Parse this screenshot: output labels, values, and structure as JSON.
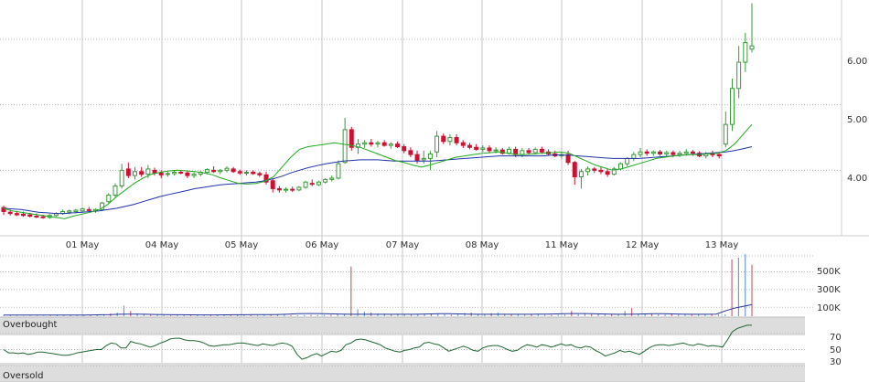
{
  "chart_data": [
    {
      "panel": "price",
      "type": "candlestick",
      "x_labels": [
        "01 May",
        "04 May",
        "05 May",
        "06 May",
        "07 May",
        "08 May",
        "11 May",
        "12 May",
        "13 May"
      ],
      "y_ticks": [
        "4.00",
        "5.00",
        "6.00"
      ],
      "ylim": [
        3.0,
        6.6
      ],
      "grid": true,
      "colors": {
        "up": "#3a9a3a",
        "down": "#cc1133",
        "ma_short": "#22aa22",
        "ma_long": "#2233aa",
        "grid": "#bbbbbb"
      },
      "candles": [
        {
          "o": 3.43,
          "h": 3.46,
          "l": 3.32,
          "c": 3.37
        },
        {
          "o": 3.36,
          "h": 3.4,
          "l": 3.31,
          "c": 3.34
        },
        {
          "o": 3.34,
          "h": 3.38,
          "l": 3.3,
          "c": 3.32
        },
        {
          "o": 3.33,
          "h": 3.37,
          "l": 3.29,
          "c": 3.31
        },
        {
          "o": 3.32,
          "h": 3.35,
          "l": 3.28,
          "c": 3.3
        },
        {
          "o": 3.3,
          "h": 3.34,
          "l": 3.27,
          "c": 3.29
        },
        {
          "o": 3.29,
          "h": 3.32,
          "l": 3.26,
          "c": 3.28
        },
        {
          "o": 3.28,
          "h": 3.33,
          "l": 3.26,
          "c": 3.31
        },
        {
          "o": 3.31,
          "h": 3.36,
          "l": 3.29,
          "c": 3.34
        },
        {
          "o": 3.34,
          "h": 3.4,
          "l": 3.32,
          "c": 3.37
        },
        {
          "o": 3.36,
          "h": 3.4,
          "l": 3.33,
          "c": 3.38
        },
        {
          "o": 3.37,
          "h": 3.41,
          "l": 3.34,
          "c": 3.39
        },
        {
          "o": 3.38,
          "h": 3.43,
          "l": 3.36,
          "c": 3.41
        },
        {
          "o": 3.4,
          "h": 3.44,
          "l": 3.37,
          "c": 3.39
        },
        {
          "o": 3.38,
          "h": 3.42,
          "l": 3.35,
          "c": 3.4
        },
        {
          "o": 3.4,
          "h": 3.52,
          "l": 3.38,
          "c": 3.5
        },
        {
          "o": 3.52,
          "h": 3.65,
          "l": 3.5,
          "c": 3.62
        },
        {
          "o": 3.62,
          "h": 3.8,
          "l": 3.58,
          "c": 3.76
        },
        {
          "o": 3.76,
          "h": 4.1,
          "l": 3.72,
          "c": 4.0
        },
        {
          "o": 4.02,
          "h": 4.12,
          "l": 3.88,
          "c": 3.92
        },
        {
          "o": 3.92,
          "h": 4.05,
          "l": 3.86,
          "c": 3.98
        },
        {
          "o": 3.98,
          "h": 4.05,
          "l": 3.9,
          "c": 3.94
        },
        {
          "o": 3.94,
          "h": 4.08,
          "l": 3.88,
          "c": 4.02
        },
        {
          "o": 4.0,
          "h": 4.04,
          "l": 3.92,
          "c": 3.96
        },
        {
          "o": 3.96,
          "h": 4.0,
          "l": 3.88,
          "c": 3.93
        },
        {
          "o": 3.94,
          "h": 3.98,
          "l": 3.9,
          "c": 3.95
        },
        {
          "o": 3.95,
          "h": 3.99,
          "l": 3.92,
          "c": 3.97
        },
        {
          "o": 3.97,
          "h": 4.0,
          "l": 3.94,
          "c": 3.96
        },
        {
          "o": 3.96,
          "h": 3.99,
          "l": 3.88,
          "c": 3.92
        },
        {
          "o": 3.92,
          "h": 3.97,
          "l": 3.88,
          "c": 3.94
        },
        {
          "o": 3.94,
          "h": 3.99,
          "l": 3.91,
          "c": 3.97
        },
        {
          "o": 3.97,
          "h": 4.03,
          "l": 3.94,
          "c": 4.01
        },
        {
          "o": 4.0,
          "h": 4.06,
          "l": 3.96,
          "c": 3.98
        },
        {
          "o": 3.98,
          "h": 4.02,
          "l": 3.94,
          "c": 4.0
        },
        {
          "o": 4.0,
          "h": 4.06,
          "l": 3.97,
          "c": 4.03
        },
        {
          "o": 4.02,
          "h": 4.05,
          "l": 3.96,
          "c": 3.98
        },
        {
          "o": 3.98,
          "h": 4.01,
          "l": 3.93,
          "c": 3.96
        },
        {
          "o": 3.96,
          "h": 4.0,
          "l": 3.92,
          "c": 3.97
        },
        {
          "o": 3.97,
          "h": 4.0,
          "l": 3.93,
          "c": 3.95
        },
        {
          "o": 3.95,
          "h": 3.98,
          "l": 3.9,
          "c": 3.93
        },
        {
          "o": 3.93,
          "h": 3.98,
          "l": 3.78,
          "c": 3.82
        },
        {
          "o": 3.84,
          "h": 3.88,
          "l": 3.66,
          "c": 3.72
        },
        {
          "o": 3.72,
          "h": 3.76,
          "l": 3.66,
          "c": 3.7
        },
        {
          "o": 3.7,
          "h": 3.74,
          "l": 3.66,
          "c": 3.71
        },
        {
          "o": 3.71,
          "h": 3.75,
          "l": 3.67,
          "c": 3.7
        },
        {
          "o": 3.7,
          "h": 3.76,
          "l": 3.68,
          "c": 3.74
        },
        {
          "o": 3.74,
          "h": 3.84,
          "l": 3.72,
          "c": 3.82
        },
        {
          "o": 3.8,
          "h": 3.86,
          "l": 3.76,
          "c": 3.79
        },
        {
          "o": 3.78,
          "h": 3.84,
          "l": 3.76,
          "c": 3.82
        },
        {
          "o": 3.82,
          "h": 3.88,
          "l": 3.8,
          "c": 3.86
        },
        {
          "o": 3.86,
          "h": 3.92,
          "l": 3.83,
          "c": 3.88
        },
        {
          "o": 3.88,
          "h": 4.15,
          "l": 3.86,
          "c": 4.1
        },
        {
          "o": 4.12,
          "h": 4.8,
          "l": 4.1,
          "c": 4.62
        },
        {
          "o": 4.62,
          "h": 4.66,
          "l": 4.3,
          "c": 4.35
        },
        {
          "o": 4.35,
          "h": 4.48,
          "l": 4.25,
          "c": 4.4
        },
        {
          "o": 4.4,
          "h": 4.46,
          "l": 4.34,
          "c": 4.42
        },
        {
          "o": 4.42,
          "h": 4.48,
          "l": 4.36,
          "c": 4.4
        },
        {
          "o": 4.4,
          "h": 4.45,
          "l": 4.35,
          "c": 4.42
        },
        {
          "o": 4.42,
          "h": 4.46,
          "l": 4.36,
          "c": 4.38
        },
        {
          "o": 4.38,
          "h": 4.43,
          "l": 4.33,
          "c": 4.4
        },
        {
          "o": 4.4,
          "h": 4.44,
          "l": 4.34,
          "c": 4.36
        },
        {
          "o": 4.36,
          "h": 4.4,
          "l": 4.26,
          "c": 4.3
        },
        {
          "o": 4.3,
          "h": 4.35,
          "l": 4.2,
          "c": 4.24
        },
        {
          "o": 4.24,
          "h": 4.3,
          "l": 4.1,
          "c": 4.15
        },
        {
          "o": 4.16,
          "h": 4.3,
          "l": 4.1,
          "c": 4.18
        },
        {
          "o": 4.18,
          "h": 4.3,
          "l": 4.0,
          "c": 4.25
        },
        {
          "o": 4.28,
          "h": 4.6,
          "l": 4.2,
          "c": 4.52
        },
        {
          "o": 4.52,
          "h": 4.56,
          "l": 4.4,
          "c": 4.44
        },
        {
          "o": 4.44,
          "h": 4.55,
          "l": 4.38,
          "c": 4.5
        },
        {
          "o": 4.5,
          "h": 4.55,
          "l": 4.38,
          "c": 4.42
        },
        {
          "o": 4.42,
          "h": 4.46,
          "l": 4.34,
          "c": 4.38
        },
        {
          "o": 4.38,
          "h": 4.42,
          "l": 4.32,
          "c": 4.35
        },
        {
          "o": 4.35,
          "h": 4.4,
          "l": 4.3,
          "c": 4.32
        },
        {
          "o": 4.32,
          "h": 4.38,
          "l": 4.28,
          "c": 4.34
        },
        {
          "o": 4.34,
          "h": 4.38,
          "l": 4.26,
          "c": 4.3
        },
        {
          "o": 4.3,
          "h": 4.35,
          "l": 4.26,
          "c": 4.31
        },
        {
          "o": 4.31,
          "h": 4.34,
          "l": 4.24,
          "c": 4.26
        },
        {
          "o": 4.26,
          "h": 4.36,
          "l": 4.24,
          "c": 4.32
        },
        {
          "o": 4.32,
          "h": 4.36,
          "l": 4.2,
          "c": 4.24
        },
        {
          "o": 4.24,
          "h": 4.34,
          "l": 4.2,
          "c": 4.3
        },
        {
          "o": 4.3,
          "h": 4.34,
          "l": 4.24,
          "c": 4.27
        },
        {
          "o": 4.27,
          "h": 4.35,
          "l": 4.24,
          "c": 4.32
        },
        {
          "o": 4.32,
          "h": 4.36,
          "l": 4.25,
          "c": 4.28
        },
        {
          "o": 4.28,
          "h": 4.32,
          "l": 4.22,
          "c": 4.25
        },
        {
          "o": 4.25,
          "h": 4.3,
          "l": 4.2,
          "c": 4.22
        },
        {
          "o": 4.22,
          "h": 4.28,
          "l": 4.18,
          "c": 4.24
        },
        {
          "o": 4.24,
          "h": 4.3,
          "l": 4.08,
          "c": 4.12
        },
        {
          "o": 4.12,
          "h": 4.14,
          "l": 3.78,
          "c": 3.9
        },
        {
          "o": 3.9,
          "h": 4.02,
          "l": 3.72,
          "c": 3.98
        },
        {
          "o": 3.98,
          "h": 4.06,
          "l": 3.92,
          "c": 4.02
        },
        {
          "o": 4.02,
          "h": 4.05,
          "l": 3.96,
          "c": 4.0
        },
        {
          "o": 4.0,
          "h": 4.06,
          "l": 3.94,
          "c": 3.98
        },
        {
          "o": 3.98,
          "h": 4.02,
          "l": 3.9,
          "c": 3.94
        },
        {
          "o": 3.94,
          "h": 4.05,
          "l": 3.92,
          "c": 4.02
        },
        {
          "o": 4.02,
          "h": 4.12,
          "l": 4.0,
          "c": 4.1
        },
        {
          "o": 4.1,
          "h": 4.2,
          "l": 4.06,
          "c": 4.18
        },
        {
          "o": 4.18,
          "h": 4.28,
          "l": 4.14,
          "c": 4.24
        },
        {
          "o": 4.24,
          "h": 4.34,
          "l": 4.2,
          "c": 4.28
        },
        {
          "o": 4.28,
          "h": 4.32,
          "l": 4.22,
          "c": 4.26
        },
        {
          "o": 4.26,
          "h": 4.3,
          "l": 4.22,
          "c": 4.28
        },
        {
          "o": 4.28,
          "h": 4.31,
          "l": 4.22,
          "c": 4.25
        },
        {
          "o": 4.25,
          "h": 4.3,
          "l": 4.2,
          "c": 4.27
        },
        {
          "o": 4.27,
          "h": 4.3,
          "l": 4.2,
          "c": 4.24
        },
        {
          "o": 4.24,
          "h": 4.3,
          "l": 4.2,
          "c": 4.26
        },
        {
          "o": 4.26,
          "h": 4.32,
          "l": 4.22,
          "c": 4.28
        },
        {
          "o": 4.28,
          "h": 4.31,
          "l": 4.22,
          "c": 4.26
        },
        {
          "o": 4.26,
          "h": 4.29,
          "l": 4.2,
          "c": 4.22
        },
        {
          "o": 4.22,
          "h": 4.28,
          "l": 4.18,
          "c": 4.25
        },
        {
          "o": 4.25,
          "h": 4.3,
          "l": 4.2,
          "c": 4.24
        },
        {
          "o": 4.24,
          "h": 4.28,
          "l": 4.18,
          "c": 4.22
        },
        {
          "o": 4.4,
          "h": 4.9,
          "l": 4.35,
          "c": 4.7
        },
        {
          "o": 4.7,
          "h": 5.4,
          "l": 4.6,
          "c": 5.25
        },
        {
          "o": 5.25,
          "h": 5.9,
          "l": 5.1,
          "c": 5.65
        },
        {
          "o": 5.65,
          "h": 6.1,
          "l": 5.5,
          "c": 5.95
        },
        {
          "o": 5.85,
          "h": 6.55,
          "l": 5.8,
          "c": 5.9
        }
      ],
      "ma_short": [
        3.42,
        3.38,
        3.36,
        3.34,
        3.32,
        3.3,
        3.28,
        3.26,
        3.3,
        3.33,
        3.36,
        3.4,
        3.48,
        3.6,
        3.7,
        3.8,
        3.88,
        3.94,
        3.97,
        3.99,
        4.0,
        3.99,
        3.98,
        3.96,
        3.93,
        3.88,
        3.84,
        3.8,
        3.79,
        3.8,
        3.83,
        3.9,
        4.05,
        4.2,
        4.32,
        4.36,
        4.38,
        4.4,
        4.42,
        4.4,
        4.38,
        4.35,
        4.3,
        4.25,
        4.2,
        4.15,
        4.12,
        4.08,
        4.05,
        4.08,
        4.12,
        4.16,
        4.2,
        4.22,
        4.24,
        4.26,
        4.27,
        4.28,
        4.26,
        4.24,
        4.24,
        4.25,
        4.26,
        4.27,
        4.28,
        4.26,
        4.2,
        4.14,
        4.08,
        4.04,
        4.0,
        4.02,
        4.06,
        4.1,
        4.14,
        4.18,
        4.2,
        4.22,
        4.23,
        4.24,
        4.24,
        4.25,
        4.26,
        4.3,
        4.4,
        4.55,
        4.7
      ],
      "ma_long": [
        3.42,
        3.41,
        3.4,
        3.38,
        3.36,
        3.35,
        3.34,
        3.34,
        3.35,
        3.36,
        3.37,
        3.38,
        3.4,
        3.42,
        3.45,
        3.48,
        3.52,
        3.56,
        3.6,
        3.63,
        3.66,
        3.69,
        3.72,
        3.74,
        3.76,
        3.78,
        3.79,
        3.8,
        3.81,
        3.82,
        3.84,
        3.87,
        3.91,
        3.96,
        4.0,
        4.04,
        4.07,
        4.1,
        4.12,
        4.14,
        4.15,
        4.16,
        4.16,
        4.16,
        4.15,
        4.14,
        4.14,
        4.14,
        4.14,
        4.14,
        4.15,
        4.16,
        4.17,
        4.18,
        4.19,
        4.2,
        4.21,
        4.22,
        4.22,
        4.22,
        4.22,
        4.22,
        4.22,
        4.23,
        4.23,
        4.23,
        4.22,
        4.21,
        4.2,
        4.19,
        4.18,
        4.18,
        4.18,
        4.18,
        4.19,
        4.2,
        4.21,
        4.22,
        4.23,
        4.24,
        4.25,
        4.26,
        4.27,
        4.28,
        4.3,
        4.33,
        4.36
      ]
    },
    {
      "panel": "volume",
      "type": "bar",
      "y_ticks": [
        "500K",
        "300K",
        "100K"
      ],
      "ylim": [
        0,
        680
      ],
      "volumes": [
        14,
        8,
        6,
        4,
        6,
        5,
        4,
        8,
        10,
        12,
        12,
        10,
        14,
        10,
        12,
        18,
        30,
        40,
        120,
        60,
        30,
        20,
        14,
        18,
        12,
        10,
        12,
        14,
        10,
        12,
        12,
        14,
        12,
        16,
        18,
        16,
        14,
        12,
        10,
        12,
        14,
        20,
        16,
        12,
        10,
        12,
        14,
        12,
        14,
        16,
        20,
        24,
        560,
        80,
        50,
        40,
        30,
        28,
        24,
        20,
        22,
        18,
        22,
        20,
        24,
        26,
        20,
        16,
        18,
        36,
        40,
        22,
        20,
        34,
        40,
        28,
        22,
        22,
        18,
        20,
        24,
        16,
        14,
        16,
        18,
        60,
        20,
        30,
        24,
        22,
        18,
        26,
        20,
        60,
        90,
        22,
        24,
        30,
        20,
        18,
        20,
        16,
        24,
        20,
        22,
        18,
        20,
        22,
        20,
        640,
        660,
        700,
        580
      ],
      "volume_ma": [
        12,
        12,
        12,
        12,
        12,
        12,
        12,
        12,
        12,
        12,
        14,
        16,
        18,
        22,
        24,
        24,
        22,
        20,
        18,
        17,
        16,
        15,
        14,
        14,
        14,
        15,
        16,
        17,
        18,
        18,
        18,
        20,
        24,
        28,
        30,
        30,
        28,
        26,
        24,
        22,
        22,
        22,
        22,
        22,
        22,
        22,
        22,
        24,
        26,
        28,
        28,
        26,
        24,
        22,
        22,
        22,
        22,
        22,
        22,
        22,
        23,
        24,
        26,
        28,
        30,
        30,
        28,
        26,
        24,
        22,
        22,
        24,
        26,
        28,
        28,
        26,
        24,
        22,
        22,
        22,
        24,
        60,
        90,
        110,
        130
      ]
    },
    {
      "panel": "rsi",
      "type": "line",
      "band_labels": {
        "overbought": "Overbought",
        "oversold": "Oversold"
      },
      "y_ticks": [
        "70",
        "50",
        "30"
      ],
      "ylim": [
        10,
        90
      ],
      "rsi": [
        50,
        46,
        46,
        45,
        46,
        44,
        45,
        47,
        47,
        46,
        45,
        44,
        43,
        43,
        44,
        46,
        47,
        48,
        49,
        50,
        50,
        55,
        58,
        57,
        52,
        52,
        60,
        58,
        57,
        55,
        53,
        55,
        58,
        60,
        63,
        64,
        64,
        62,
        61,
        61,
        60,
        58,
        55,
        54,
        55,
        56,
        56,
        57,
        58,
        58,
        57,
        56,
        55,
        57,
        56,
        55,
        57,
        58,
        57,
        54,
        44,
        38,
        40,
        43,
        45,
        42,
        45,
        48,
        47,
        49,
        56,
        58,
        62,
        63,
        62,
        60,
        58,
        56,
        52,
        50,
        48,
        47,
        49,
        50,
        52,
        53,
        58,
        59,
        57,
        56,
        52,
        48,
        50,
        52,
        54,
        52,
        49,
        48,
        52,
        54,
        55,
        55,
        53,
        50,
        48,
        49,
        53,
        56,
        55,
        53,
        56,
        55,
        53,
        55,
        57,
        55,
        56,
        53,
        52,
        54,
        53,
        49,
        46,
        42,
        44,
        46,
        49,
        47,
        48,
        46,
        44,
        48,
        52,
        55,
        56,
        56,
        55,
        56,
        57,
        58,
        56,
        55,
        57,
        56,
        54,
        55,
        54,
        53,
        62,
        72,
        76,
        78,
        80,
        80
      ]
    }
  ]
}
